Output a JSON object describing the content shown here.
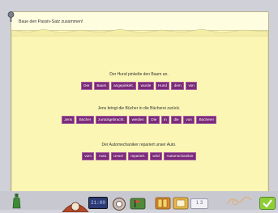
{
  "instruction": "Baue den Passiv-Satz zusammen!",
  "tasks": [
    {
      "sentence": "Der Hund pinkelte den Baum an.",
      "tiles": [
        "Der",
        "Baum",
        "angepinkelt.",
        "wurde",
        "Hund",
        "dem",
        "von"
      ]
    },
    {
      "sentence": "Jens bringt die Bücher in die Bücherei zurück.",
      "tiles": [
        "Jens",
        "Bücher",
        "zurückgebracht.",
        "werden",
        "Die",
        "in",
        "die",
        "von",
        "Bücherei"
      ]
    },
    {
      "sentence": "Der Automechaniker repariert unser Auto.",
      "tiles": [
        "vom",
        "Auto",
        "Unser",
        "repariert.",
        "wird",
        "Automechaniker"
      ]
    }
  ],
  "toolbar": {
    "clock": "21:00",
    "page_indicator": "1 3",
    "colors": {
      "ok": "#8fce3a",
      "tile": "#7b2b78",
      "clock": "#2c3a74"
    }
  },
  "icons": [
    "pin-icon",
    "bottle-icon",
    "ring-icon",
    "clock-display",
    "flag-icon",
    "book-icon",
    "card-icon",
    "page-icon",
    "doodle-icon",
    "check-icon"
  ]
}
